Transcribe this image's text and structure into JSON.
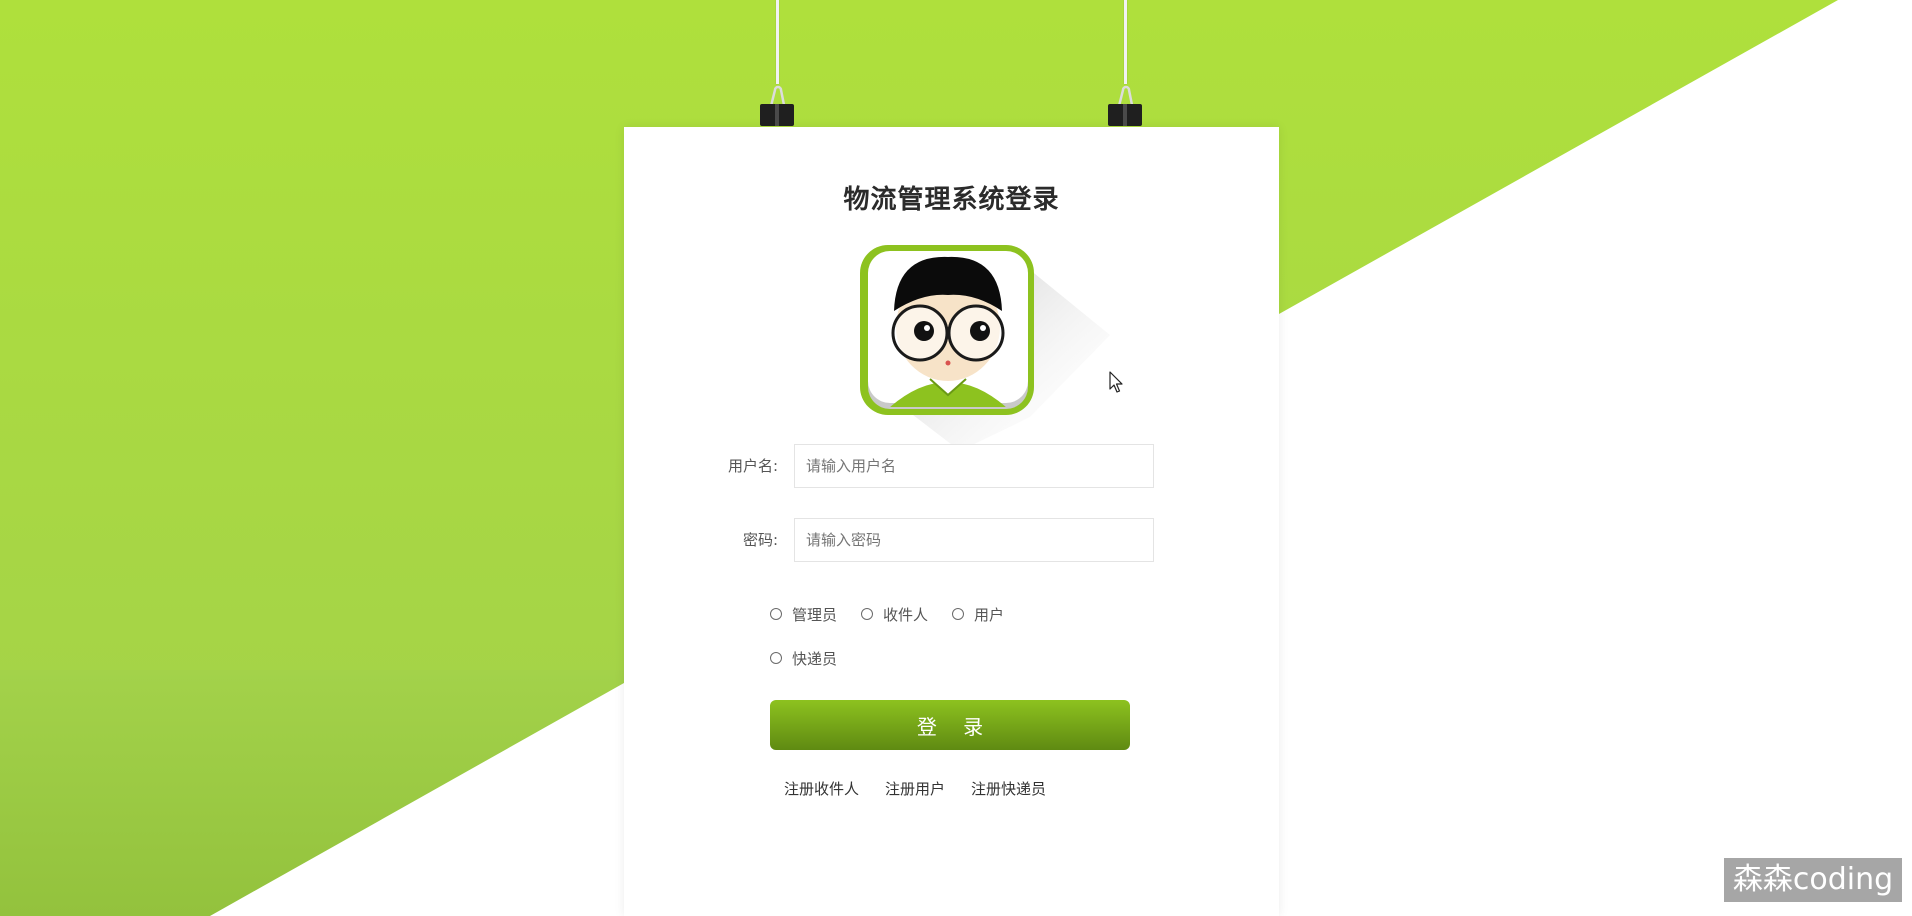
{
  "login": {
    "title": "物流管理系统登录",
    "username_label": "用户名:",
    "username_placeholder": "请输入用户名",
    "password_label": "密码:",
    "password_placeholder": "请输入密码",
    "roles": [
      "管理员",
      "收件人",
      "用户",
      "快递员"
    ],
    "login_button": "登 录",
    "register_links": [
      "注册收件人",
      "注册用户",
      "注册快递员"
    ]
  },
  "watermark": "森森coding",
  "colors": {
    "accent_green": "#8dc21f",
    "button_dark_green": "#5f8a12",
    "background_green": "#a8d840"
  }
}
